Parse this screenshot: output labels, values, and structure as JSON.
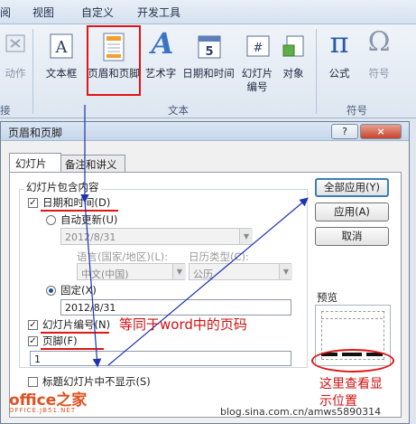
{
  "ribbon": {
    "tabs": [
      "阅",
      "视图",
      "自定义",
      "开发工具"
    ],
    "buttons": {
      "action": "动作",
      "textbox": "文本框",
      "header_footer": "页眉和页脚",
      "wordart": "艺术字",
      "datetime": "日期和时间",
      "slide_number_line1": "幻灯片",
      "slide_number_line2": "编号",
      "object": "对象",
      "formula": "公式",
      "symbol": "符号"
    },
    "groups": {
      "left_partial": "接",
      "text": "文本",
      "symbols": "符号"
    },
    "icon_glyphs": {
      "textbox": "A",
      "wordart": "A",
      "formula": "π",
      "symbol": "Ω",
      "calendar_day": "5",
      "slide_num": "#"
    }
  },
  "dialog": {
    "title": "页眉和页脚",
    "help_button": "?",
    "close_button": "×",
    "tabs": [
      "幻灯片",
      "备注和讲义"
    ],
    "section_label": "幻灯片包含内容",
    "datetime_checkbox": "日期和时间(D)",
    "auto_update_radio": "自动更新(U)",
    "auto_date_value": "2012/8/31",
    "language_label": "语言(国家/地区)(L):",
    "calendar_type_label": "日历类型(C):",
    "language_value": "中文(中国)",
    "calendar_value": "公历",
    "fixed_radio": "固定(X)",
    "fixed_value": "2012/8/31",
    "slide_number_checkbox": "幻灯片编号(N)",
    "footer_checkbox": "页脚(F)",
    "footer_value": "1",
    "hide_title_checkbox": "标题幻灯片中不显示(S)",
    "buttons": {
      "apply_all": "全部应用(Y)",
      "apply": "应用(A)",
      "cancel": "取消"
    },
    "preview_label": "预览",
    "checked_mark": "✓"
  },
  "annotations": {
    "page_number_note": "等同于word中的页码",
    "preview_note_line1": "这里查看显",
    "preview_note_line2": "示位置"
  },
  "watermarks": {
    "logo": "office之家",
    "logo_sub": "OFFICE.JB51.NET",
    "blog": "blog.sina.com.cn/amws5890314"
  },
  "colors": {
    "annotation_red": "#d21010",
    "arrow_blue": "#1e32b4",
    "dialog_bg": "#f0f0f0"
  }
}
